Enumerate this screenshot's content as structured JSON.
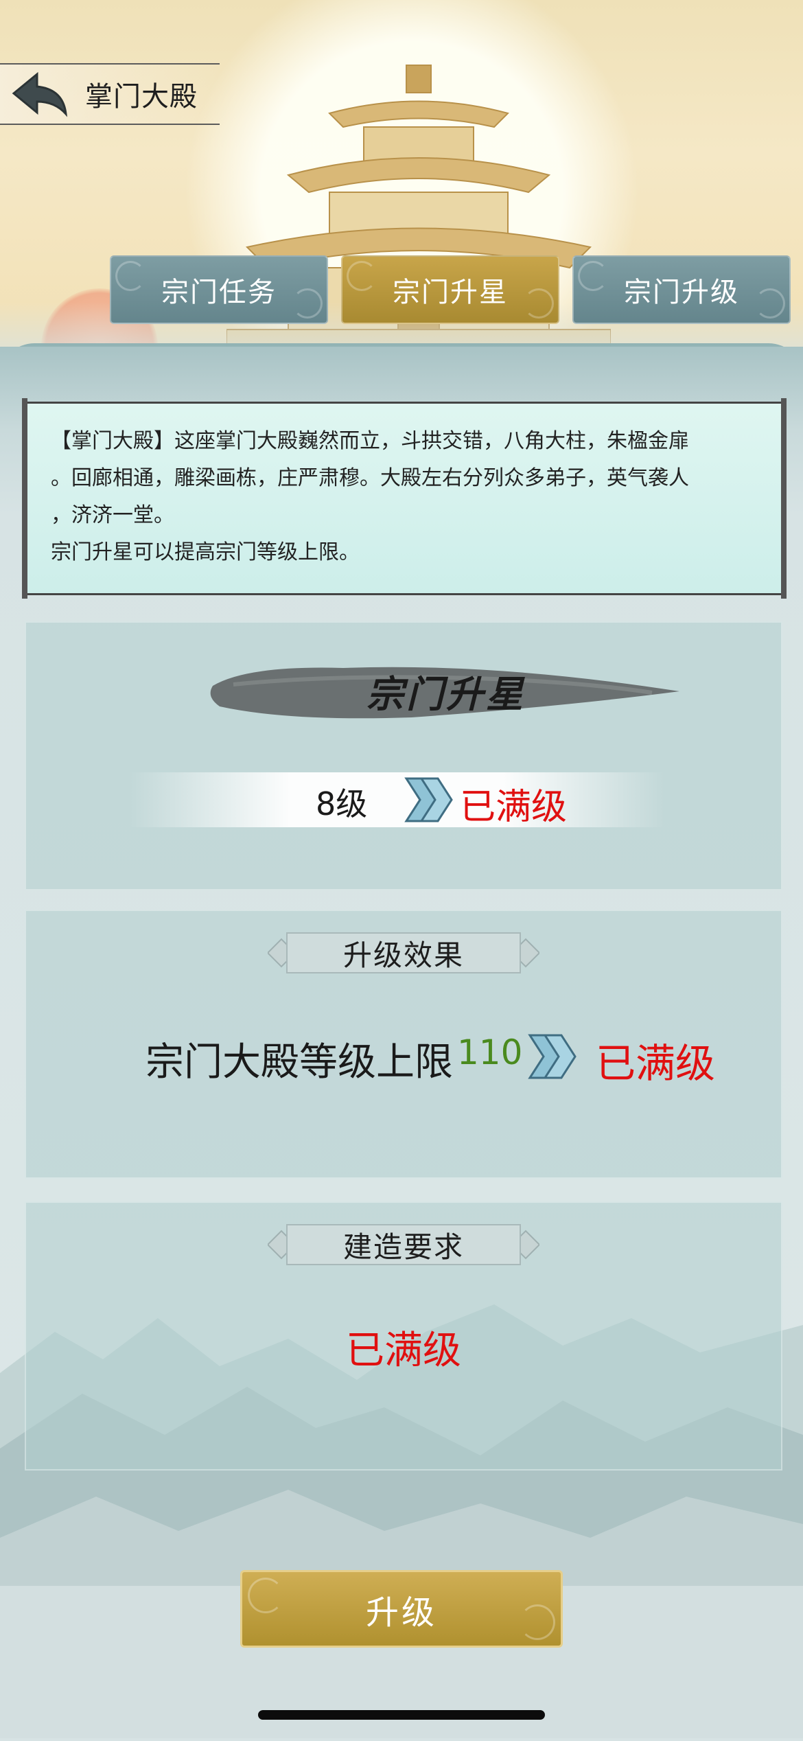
{
  "header": {
    "title": "掌门大殿"
  },
  "tabs": [
    {
      "label": "宗门任务",
      "active": false
    },
    {
      "label": "宗门升星",
      "active": true
    },
    {
      "label": "宗门升级",
      "active": false
    }
  ],
  "description": {
    "lines": [
      "【掌门大殿】这座掌门大殿巍然而立，斗拱交错，八角大柱，朱楹金扉",
      "。回廊相通，雕梁画栋，庄严肃穆。大殿左右分列众多弟子，英气袭人",
      "，济济一堂。",
      "宗门升星可以提高宗门等级上限。"
    ]
  },
  "star_card": {
    "title": "宗门升星",
    "current_level": "8级",
    "next_level": "已满级"
  },
  "effect_card": {
    "heading": "升级效果",
    "label": "宗门大殿等级上限",
    "current_value": "110",
    "next_value": "已满级"
  },
  "requirement_card": {
    "heading": "建造要求",
    "status": "已满级"
  },
  "action": {
    "upgrade_label": "升级"
  },
  "colors": {
    "accent_gold": "#b0912f",
    "tab_grey": "#6b8b92",
    "max_red": "#e01010",
    "value_green": "#4a8a1e"
  },
  "icons": {
    "back": "back-arrow-icon",
    "arrow": "double-chevron-right-icon"
  }
}
